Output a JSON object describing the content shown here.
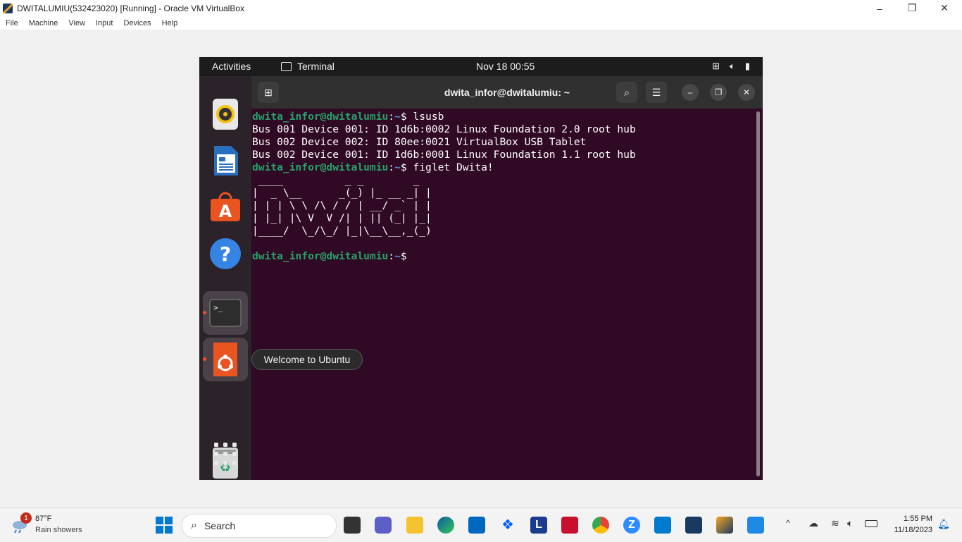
{
  "host": {
    "window_title": "DWITALUMIU(532423020) [Running] - Oracle VM VirtualBox",
    "menu": [
      "File",
      "Machine",
      "View",
      "Input",
      "Devices",
      "Help"
    ],
    "controls": {
      "minimize": "–",
      "restore": "❐",
      "close": "✕"
    }
  },
  "ubuntu": {
    "topbar": {
      "activities": "Activities",
      "app": "Terminal",
      "clock": "Nov 18  00:55"
    },
    "dock": {
      "items": [
        "rhythmbox-icon",
        "libreoffice-writer-icon",
        "app-center-icon",
        "help-icon",
        "terminal-icon",
        "welcome-ubuntu-icon",
        "trash-icon",
        "show-apps-icon"
      ],
      "tooltip": "Welcome to Ubuntu"
    },
    "terminal": {
      "title": "dwita_infor@dwitalumiu: ~",
      "prompt_user": "dwita_infor@dwitalumiu",
      "prompt_path": "~",
      "prompt_tail": "$ ",
      "cmd1": "lsusb",
      "out1": "Bus 001 Device 001: ID 1d6b:0002 Linux Foundation 2.0 root hub",
      "out2": "Bus 002 Device 002: ID 80ee:0021 VirtualBox USB Tablet",
      "out3": "Bus 002 Device 001: ID 1d6b:0001 Linux Foundation 1.1 root hub",
      "cmd2": "figlet Dwita!",
      "figlet": [
        " ____          _ _        _ ",
        "|  _ \\__      _(_) |_ __ _| |",
        "| | | \\ \\ /\\ / / | __/ _` | |",
        "| |_| |\\ V  V /| | || (_| |_|",
        "|____/  \\_/\\_/ |_|\\__\\__,_(_)"
      ]
    }
  },
  "taskbar": {
    "weather_temp": "87°F",
    "weather_desc": "Rain showers",
    "weather_badge": "1",
    "search_placeholder": "Search",
    "time": "1:55 PM",
    "date": "11/18/2023",
    "colors": {
      "accent": "#0067c0",
      "ubuntu_orange": "#e95420"
    }
  }
}
